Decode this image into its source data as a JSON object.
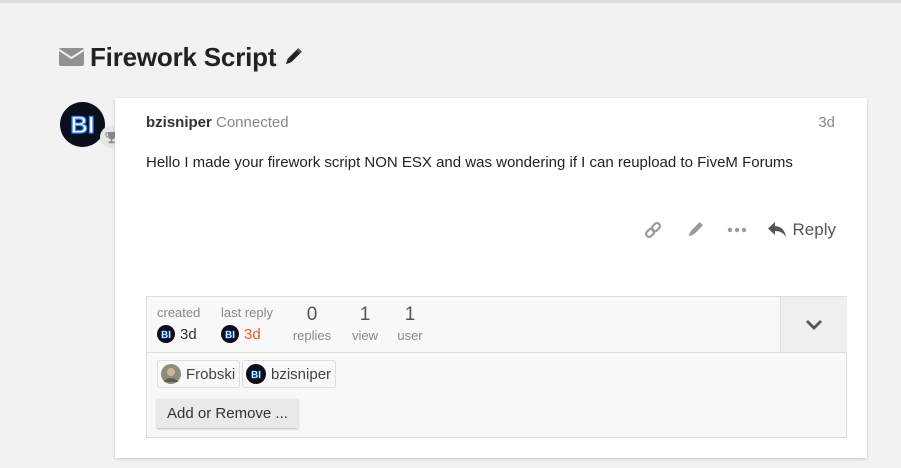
{
  "topic": {
    "title": "Firework Script"
  },
  "post": {
    "username": "bzisniper",
    "status": "Connected",
    "age": "3d",
    "body": "Hello I made your firework script NON ESX and was wondering if I can reupload to FiveM Forums",
    "avatar_text": "BI"
  },
  "actions": {
    "reply_label": "Reply",
    "icons": [
      "link-icon",
      "pencil-icon",
      "more-icon",
      "reply-icon"
    ]
  },
  "topic_map": {
    "created_label": "created",
    "created_value": "3d",
    "last_reply_label": "last reply",
    "last_reply_value": "3d",
    "replies_count": "0",
    "replies_label": "replies",
    "views_count": "1",
    "views_label": "view",
    "users_count": "1",
    "users_label": "user",
    "participants": [
      {
        "name": "Frobski"
      },
      {
        "name": "bzisniper"
      }
    ],
    "add_remove_label": "Add or Remove ..."
  },
  "colors": {
    "accent_reply_recent": "#e45735",
    "background": "#f2f2f2",
    "card": "#ffffff",
    "avatar_glow": "#3a8fff"
  }
}
